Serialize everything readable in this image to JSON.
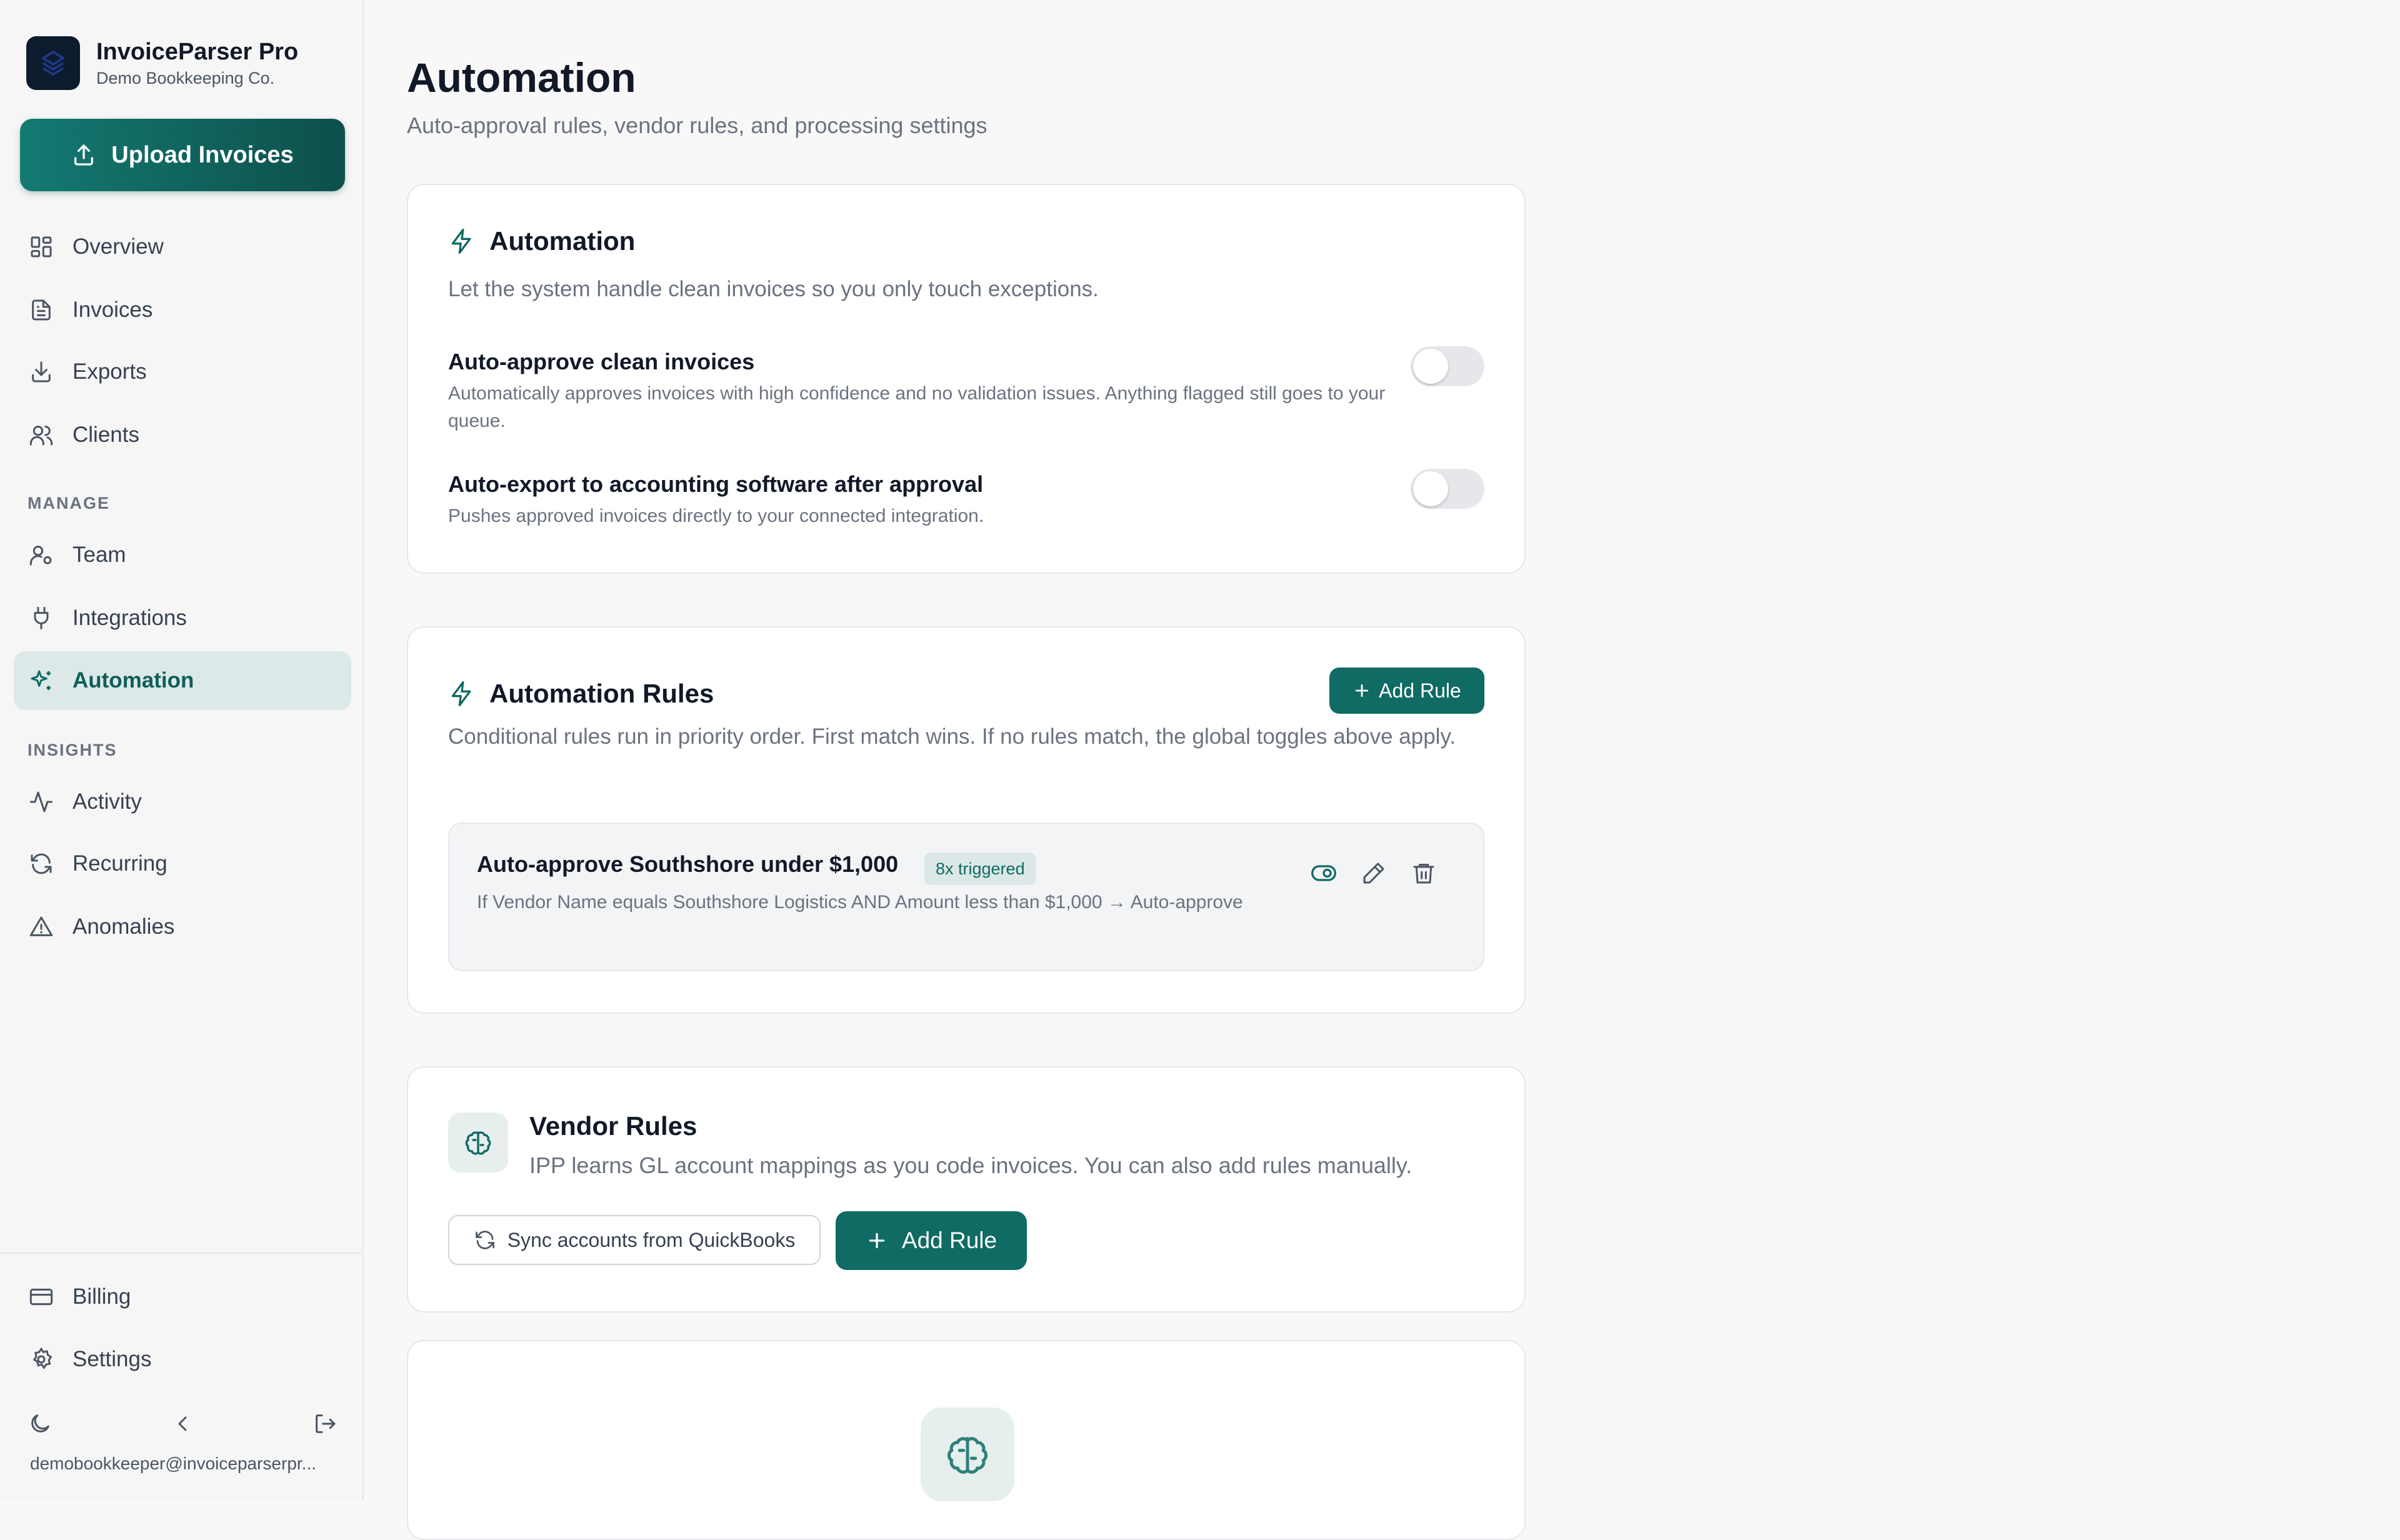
{
  "app": {
    "name": "InvoiceParser Pro",
    "org": "Demo Bookkeeping Co.",
    "upload_label": "Upload Invoices"
  },
  "nav": {
    "main": [
      {
        "label": "Overview",
        "icon": "grid-icon"
      },
      {
        "label": "Invoices",
        "icon": "document-icon"
      },
      {
        "label": "Exports",
        "icon": "download-icon"
      },
      {
        "label": "Clients",
        "icon": "users-icon"
      }
    ],
    "manage_label": "MANAGE",
    "manage": [
      {
        "label": "Team",
        "icon": "user-cog-icon"
      },
      {
        "label": "Integrations",
        "icon": "plug-icon"
      },
      {
        "label": "Automation",
        "icon": "sparkles-icon",
        "active": true
      }
    ],
    "insights_label": "INSIGHTS",
    "insights": [
      {
        "label": "Activity",
        "icon": "activity-icon"
      },
      {
        "label": "Recurring",
        "icon": "refresh-icon"
      },
      {
        "label": "Anomalies",
        "icon": "warning-icon"
      }
    ],
    "bottom": [
      {
        "label": "Billing",
        "icon": "credit-card-icon"
      },
      {
        "label": "Settings",
        "icon": "gear-icon"
      }
    ],
    "user_email": "demobookkeeper@invoiceparserpr..."
  },
  "page": {
    "title": "Automation",
    "subtitle": "Auto-approval rules, vendor rules, and processing settings"
  },
  "automation_card": {
    "title": "Automation",
    "description": "Let the system handle clean invoices so you only touch exceptions.",
    "settings": [
      {
        "title": "Auto-approve clean invoices",
        "description": "Automatically approves invoices with high confidence and no validation issues. Anything flagged still goes to your queue.",
        "enabled": false
      },
      {
        "title": "Auto-export to accounting software after approval",
        "description": "Pushes approved invoices directly to your connected integration.",
        "enabled": false
      }
    ]
  },
  "rules_card": {
    "title": "Automation Rules",
    "add_label": "Add Rule",
    "description": "Conditional rules run in priority order. First match wins. If no rules match, the global toggles above apply.",
    "rules": [
      {
        "title": "Auto-approve Southshore under $1,000",
        "badge": "8x triggered",
        "description": "If Vendor Name equals Southshore Logistics AND Amount less than $1,000 → Auto-approve"
      }
    ]
  },
  "vendor_card": {
    "title": "Vendor Rules",
    "description": "IPP learns GL account mappings as you code invoices. You can also add rules manually.",
    "sync_label": "Sync accounts from QuickBooks",
    "add_label": "Add Rule"
  },
  "colors": {
    "accent": "#0f6b63",
    "accent_light": "#dde9e8",
    "sidebar_bg": "#f6f6f6",
    "page_bg": "#f8f8f8"
  }
}
